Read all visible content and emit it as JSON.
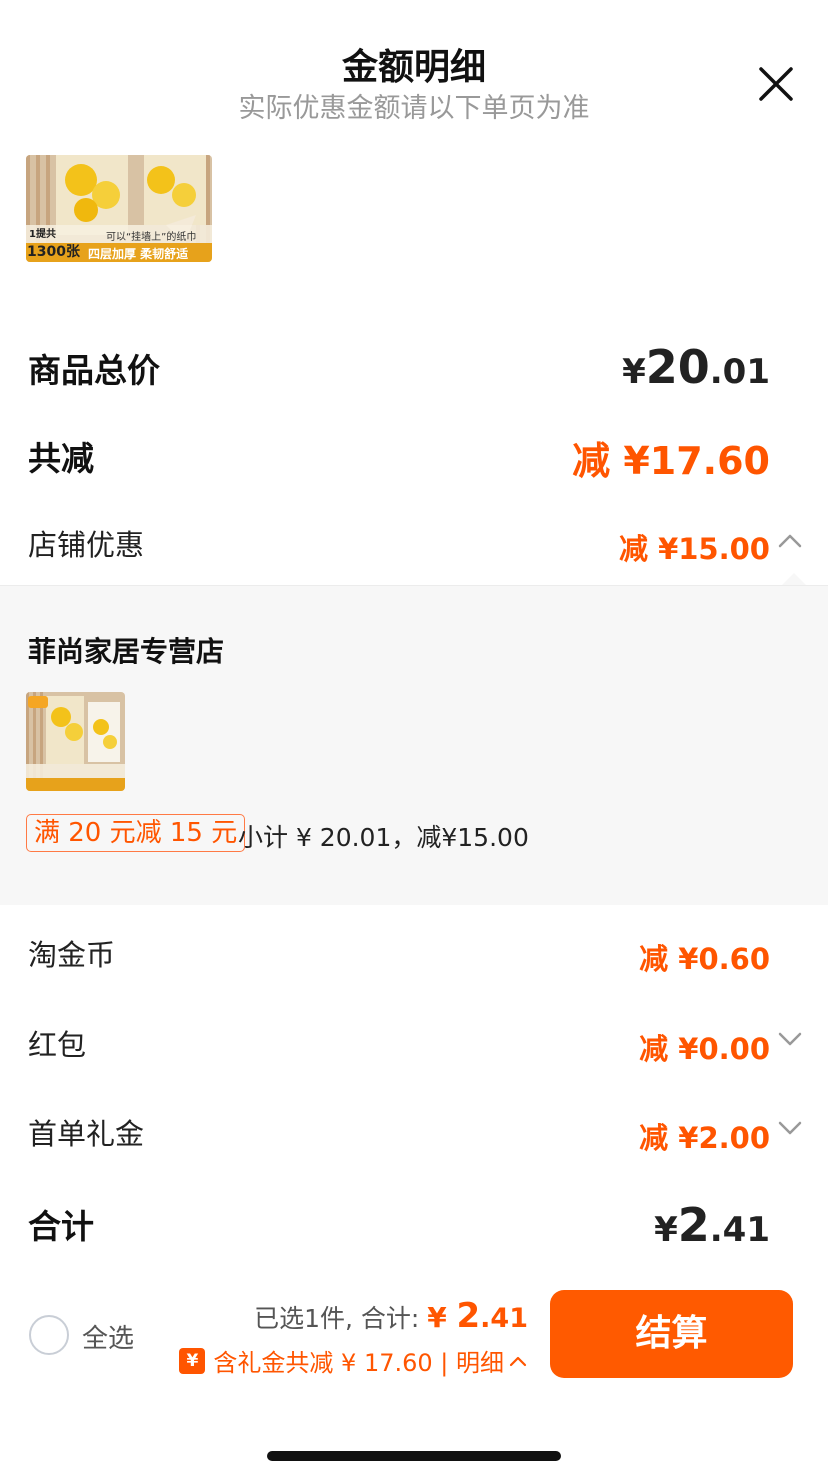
{
  "header": {
    "title": "金额明细",
    "subtitle": "实际优惠金额请以下单页为准"
  },
  "product_image_text": {
    "count_line1": "1提共",
    "count_line2": "1300张",
    "caption1": "可以“挂墙上”的纸巾",
    "caption2": "四层加厚 柔韧舒适"
  },
  "rows": {
    "total_price": {
      "label": "商品总价",
      "currency": "¥",
      "int": "20",
      "dec": ".01"
    },
    "total_discount": {
      "label": "共减",
      "value": "减 ¥17.60"
    },
    "shop_discount": {
      "label": "店铺优惠",
      "value": "减 ¥15.00"
    }
  },
  "shop": {
    "name": "菲尚家居专营店",
    "promo_tag": "满 20 元减 15 元",
    "promo_text": "小计 ¥ 20.01，减¥15.00"
  },
  "more_rows": {
    "coins": {
      "label": "淘金币",
      "value": "减 ¥0.60"
    },
    "red_packet": {
      "label": "红包",
      "value": "减 ¥0.00"
    },
    "first_gift": {
      "label": "首单礼金",
      "value": "减 ¥2.00"
    },
    "sum": {
      "label": "合计",
      "currency": "¥",
      "int": "2",
      "dec": ".41"
    }
  },
  "footer": {
    "select_all": "全选",
    "selected_text": "已选1件, 合计:",
    "amount_currency": "¥ ",
    "amount_int": "2",
    "amount_dec": ".41",
    "gift_icon": "¥",
    "gift_text": "含礼金共减 ¥ 17.60 | 明细",
    "checkout": "结算"
  },
  "colors": {
    "accent": "#ff5500",
    "button": "#ff5a00",
    "panel_bg": "#f7f7f7"
  },
  "icons": [
    "close-icon",
    "chevron-up-icon",
    "chevron-down-icon",
    "radio-icon",
    "gift-coupon-icon"
  ]
}
